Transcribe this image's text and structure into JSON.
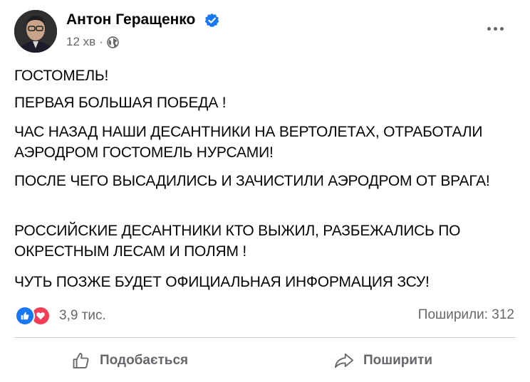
{
  "post": {
    "author": "Антон Геращенко",
    "time": "12 хв",
    "separator": "·",
    "paragraphs": [
      "ГОСТОМЕЛЬ!",
      "ПЕРВАЯ БОЛЬШАЯ ПОБЕДА !",
      "ЧАС НАЗАД НАШИ ДЕСАНТНИКИ НА ВЕРТОЛЕТАХ, ОТРАБОТАЛИ АЭРОДРОМ ГОСТОМЕЛЬ НУРСАМИ!",
      "ПОСЛЕ ЧЕГО ВЫСАДИЛИСЬ И ЗАЧИСТИЛИ АЭРОДРОМ ОТ ВРАГА!",
      "РОССИЙСКИЕ ДЕСАНТНИКИ КТО ВЫЖИЛ, РАЗБЕЖАЛИСЬ ПО ОКРЕСТНЫМ ЛЕСАМ И ПОЛЯМ !",
      "ЧУТЬ ПОЗЖЕ БУДЕТ ОФИЦИАЛЬНАЯ ИНФОРМАЦИЯ ЗСУ!"
    ]
  },
  "stats": {
    "reactions_count": "3,9 тис.",
    "shares_label": "Поширили: 312"
  },
  "actions": {
    "like_label": "Подобається",
    "share_label": "Поширити"
  },
  "icons": {
    "verified": "verified-badge-icon",
    "audience": "globe-icon",
    "more": "more-options-icon",
    "reaction_like": "like-reaction-icon",
    "reaction_love": "love-reaction-icon",
    "like_action": "thumbs-up-icon",
    "share_action": "share-arrow-icon"
  },
  "colors": {
    "accent": "#1877f2",
    "love": "#f33e58",
    "secondary_text": "#65676b",
    "primary_text": "#050505"
  }
}
